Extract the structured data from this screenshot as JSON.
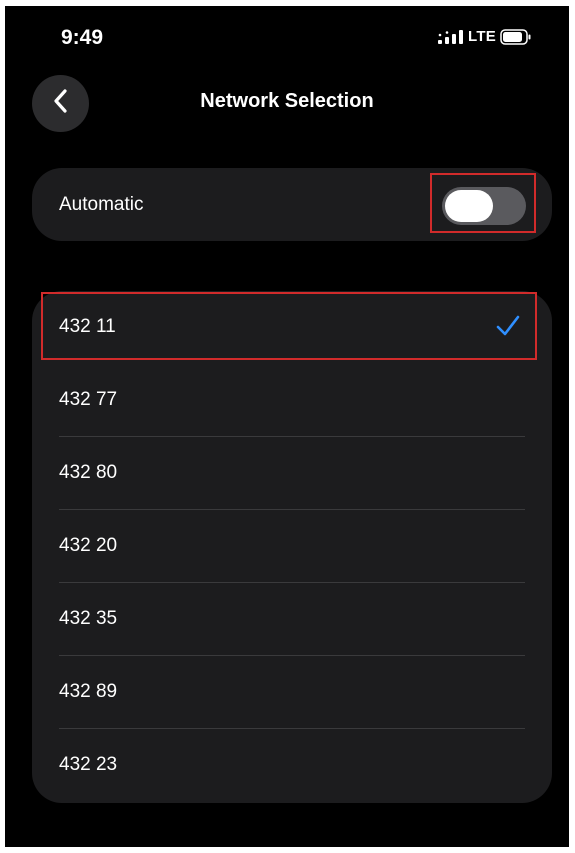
{
  "status_bar": {
    "time": "9:49",
    "network_type": "LTE"
  },
  "header": {
    "title": "Network Selection"
  },
  "automatic": {
    "label": "Automatic",
    "enabled": false
  },
  "networks": [
    {
      "label": "432 11",
      "selected": true
    },
    {
      "label": "432 77",
      "selected": false
    },
    {
      "label": "432 80",
      "selected": false
    },
    {
      "label": "432 20",
      "selected": false
    },
    {
      "label": "432 35",
      "selected": false
    },
    {
      "label": "432 89",
      "selected": false
    },
    {
      "label": "432 23",
      "selected": false
    }
  ],
  "colors": {
    "background": "#000000",
    "card": "#1c1c1e",
    "accent": "#2f8fff",
    "highlight": "#d12b2b"
  },
  "icons": [
    "back-icon",
    "signal-icon",
    "battery-icon",
    "check-icon"
  ]
}
